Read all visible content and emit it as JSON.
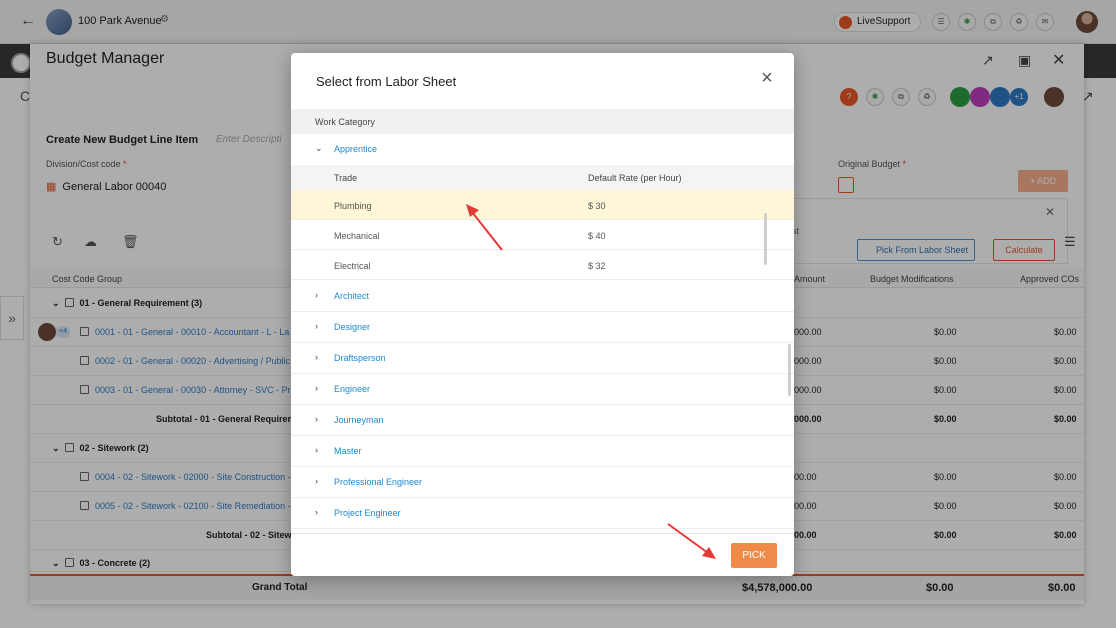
{
  "topbar": {
    "project_name": "100 Park Avenue",
    "live_support": "LiveSupport"
  },
  "panel": {
    "title": "Budget Manager",
    "create_label": "Create New Budget Line Item",
    "description_placeholder": "Enter Descripti",
    "division_label": "Division/Cost code",
    "division_value": "General Labor 00040",
    "original_budget_label": "Original Budget",
    "add_label": "+ ADD",
    "pick_labor_label": "Pick From Labor Sheet",
    "calculate_label": "Calculate",
    "estimate_text": "st",
    "avatar_count": "+1",
    "row_avatar_count": "+4",
    "columns": {
      "cost_code_group": "Cost Code Group",
      "amount": "Amount",
      "budget_mods": "Budget Modifications",
      "approved_cos": "Approved COs"
    },
    "groups": [
      {
        "label": "01 - General Requirement (3)"
      },
      {
        "label": "02 - Sitework (2)"
      },
      {
        "label": "03 - Concrete (2)"
      }
    ],
    "rows": [
      {
        "code": "0001 - 01 - General - 00010 - Accountant - L - La",
        "amount": "000.00",
        "mods": "$0.00",
        "cos": "$0.00"
      },
      {
        "code": "0002 - 01 - General - 00020 - Advertising / Public",
        "amount": "000.00",
        "mods": "$0.00",
        "cos": "$0.00"
      },
      {
        "code": "0003 - 01 - General - 00030 - Attorney - SVC - Pro",
        "amount": "000.00",
        "mods": "$0.00",
        "cos": "$0.00"
      },
      {
        "code": "0004 - 02 - Sitework - 02000 - Site Construction -",
        "amount": "00.00",
        "mods": "$0.00",
        "cos": "$0.00"
      },
      {
        "code": "0005 - 02 - Sitework - 02100 - Site Remediation -",
        "amount": "00.00",
        "mods": "$0.00",
        "cos": "$0.00"
      }
    ],
    "subtotals": [
      {
        "label": "Subtotal - 01 - General Requirem",
        "amount": "000.00",
        "mods": "$0.00",
        "cos": "$0.00"
      },
      {
        "label": "Subtotal - 02 - Sitew",
        "amount": "00.00",
        "mods": "$0.00",
        "cos": "$0.00"
      }
    ],
    "grand_total": {
      "label": "Grand Total",
      "amount": "$4,578,000.00",
      "mods": "$0.00",
      "cos": "$0.00"
    }
  },
  "modal": {
    "title": "Select from Labor Sheet",
    "work_category_header": "Work Category",
    "trade_header": "Trade",
    "rate_header": "Default Rate (per Hour)",
    "expanded_category": "Apprentice",
    "trades": [
      {
        "name": "Plumbing",
        "rate": "$ 30",
        "selected": true
      },
      {
        "name": "Mechanical",
        "rate": "$ 40",
        "selected": false
      },
      {
        "name": "Electrical",
        "rate": "$ 32",
        "selected": false
      }
    ],
    "categories": [
      "Architect",
      "Designer",
      "Draftsperson",
      "Engineer",
      "Journeyman",
      "Master",
      "Professional Engineer",
      "Project Engineer"
    ],
    "pick_label": "PICK"
  },
  "colors": {
    "accent": "#f08a48",
    "link": "#1e88d2",
    "selected_row": "#fdf6d8",
    "annotation_arrow": "#e53935"
  },
  "icons": [
    "back-arrow-icon",
    "gear-icon",
    "close-icon",
    "chevron-down-icon",
    "chevron-right-icon",
    "refresh-icon",
    "upload-cloud-icon",
    "trash-icon",
    "calendar-icon",
    "menu-icon",
    "external-link-icon",
    "expand-icon"
  ]
}
